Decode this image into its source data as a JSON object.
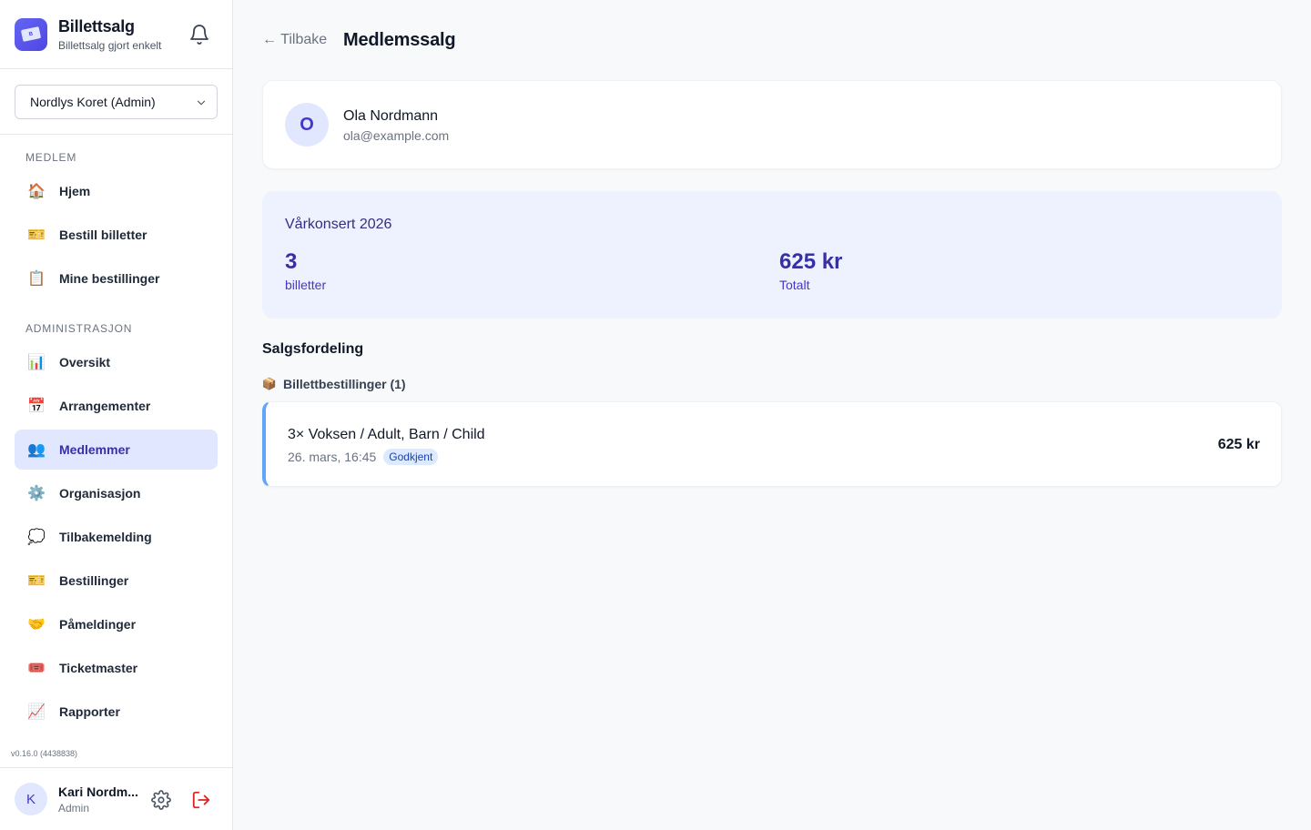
{
  "brand": {
    "title": "Billettsalg",
    "subtitle": "Billettsalg gjort enkelt"
  },
  "org_select": {
    "value": "Nordlys Koret (Admin)"
  },
  "sidebar": {
    "sections": [
      {
        "label": "MEDLEM"
      },
      {
        "label": "ADMINISTRASJON"
      }
    ],
    "items": [
      {
        "label": "Hjem",
        "icon": "house-icon"
      },
      {
        "label": "Bestill billetter",
        "icon": "ticket-icon"
      },
      {
        "label": "Mine bestillinger",
        "icon": "clipboard-icon"
      },
      {
        "label": "Oversikt",
        "icon": "bar-chart-icon"
      },
      {
        "label": "Arrangementer",
        "icon": "calendar-icon"
      },
      {
        "label": "Medlemmer",
        "icon": "users-icon",
        "active": true
      },
      {
        "label": "Organisasjon",
        "icon": "gear-icon"
      },
      {
        "label": "Tilbakemelding",
        "icon": "speech-bubble-icon"
      },
      {
        "label": "Bestillinger",
        "icon": "ticket-icon"
      },
      {
        "label": "Påmeldinger",
        "icon": "handshake-icon"
      },
      {
        "label": "Ticketmaster",
        "icon": "admission-ticket-icon"
      },
      {
        "label": "Rapporter",
        "icon": "line-chart-icon"
      }
    ],
    "version": "v0.16.0 (4438838)"
  },
  "user": {
    "initial": "K",
    "name": "Kari Nordm...",
    "role": "Admin"
  },
  "main": {
    "back_label": "← Tilbake",
    "title": "Medlemssalg",
    "member": {
      "initial": "O",
      "name": "Ola Nordmann",
      "email": "ola@example.com"
    },
    "event": {
      "title": "Vårkonsert 2026",
      "tickets_value": "3",
      "tickets_label": "billetter",
      "total_value": "625 kr",
      "total_label": "Totalt"
    },
    "breakdown_title": "Salgsfordeling",
    "orders_heading": "Billettbestillinger (1)",
    "orders": [
      {
        "title": "3× Voksen / Adult, Barn / Child",
        "date": "26. mars, 16:45",
        "status": "Godkjent",
        "amount": "625 kr"
      }
    ]
  },
  "colors": {
    "accent": "#4f46e5",
    "active_bg": "#e0e7ff",
    "order_border": "#60a5fa",
    "event_bg": "#eef2ff"
  }
}
